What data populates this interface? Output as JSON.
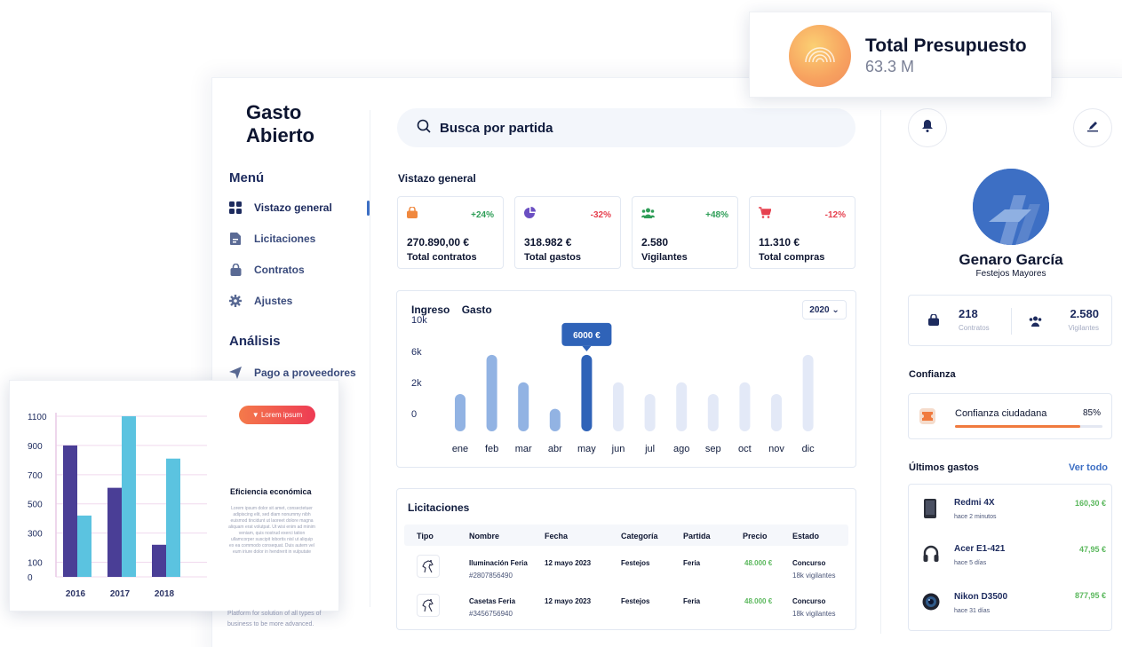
{
  "app_title_line1": "Gasto",
  "app_title_line2": "Abierto",
  "menu": {
    "title": "Menú",
    "items": [
      {
        "label": "Vistazo general",
        "icon": "grid-icon"
      },
      {
        "label": "Licitaciones",
        "icon": "document-icon"
      },
      {
        "label": "Contratos",
        "icon": "bag-icon"
      },
      {
        "label": "Ajustes",
        "icon": "gear-icon"
      }
    ]
  },
  "analysis": {
    "title": "Análisis",
    "items": [
      {
        "label": "Pago a proveedores",
        "icon": "send-icon"
      }
    ]
  },
  "search": {
    "label": "Busca por partida"
  },
  "overview": {
    "title": "Vistazo general",
    "cards": [
      {
        "pct": "+24%",
        "value": "270.890,00 €",
        "label": "Total contratos",
        "color": "#f0883e",
        "pct_color": "#2f9e58"
      },
      {
        "pct": "-32%",
        "value": "318.982 €",
        "label": "Total gastos",
        "color": "#6b4fc2",
        "pct_color": "#e6414f"
      },
      {
        "pct": "+48%",
        "value": "2.580",
        "label": "Vigilantes",
        "color": "#2f9e58",
        "pct_color": "#2f9e58"
      },
      {
        "pct": "-12%",
        "value": "11.310 €",
        "label": "Total compras",
        "color": "#e6414f",
        "pct_color": "#e6414f"
      }
    ]
  },
  "chart_panel": {
    "tab_income": "Ingreso",
    "tab_expense": "Gasto",
    "year": "2020 ⌄",
    "tooltip": "6000 €"
  },
  "chart_data": {
    "type": "bar",
    "categories": [
      "ene",
      "feb",
      "mar",
      "abr",
      "may",
      "jun",
      "jul",
      "ago",
      "sep",
      "oct",
      "nov",
      "dic"
    ],
    "values": [
      3800,
      7800,
      5000,
      2300,
      7800,
      5000,
      3800,
      5000,
      3800,
      5000,
      3800,
      7800
    ],
    "highlight_index": 4,
    "yticks": [
      "0",
      "2k",
      "6k",
      "10k"
    ],
    "ylim": [
      0,
      9600
    ],
    "colors": {
      "past": "#92b3e3",
      "highlight": "#2f63b8",
      "future": "#e3e9f7"
    }
  },
  "licitaciones": {
    "title": "Licitaciones",
    "headers": [
      "Tipo",
      "Nombre",
      "Fecha",
      "Categoría",
      "Partida",
      "Precio",
      "Estado"
    ],
    "rows": [
      {
        "name": "Iluminación Feria",
        "code": "#2807856490",
        "date": "12 mayo 2023",
        "category": "Festejos",
        "partida": "Feria",
        "price": "48.000 €",
        "status": "Concurso",
        "status_sub": "18k vigilantes"
      },
      {
        "name": "Casetas Feria",
        "code": "#3456756940",
        "date": "12 mayo 2023",
        "category": "Festejos",
        "partida": "Feria",
        "price": "48.000 €",
        "status": "Concurso",
        "status_sub": "18k vigilantes"
      }
    ]
  },
  "user": {
    "name": "Genaro García",
    "role": "Festejos Mayores",
    "contracts_value": "218",
    "contracts_label": "Contratos",
    "watchers_value": "2.580",
    "watchers_label": "Vigilantes"
  },
  "trust": {
    "title": "Confianza",
    "label": "Confianza ciudadana",
    "pct": "85%",
    "fraction": 0.85
  },
  "expenses": {
    "title": "Últimos gastos",
    "see_all": "Ver todo",
    "items": [
      {
        "name": "Redmi 4X",
        "time": "hace 2 minutos",
        "amount": "160,30 €",
        "icon": "phone-icon"
      },
      {
        "name": "Acer E1-421",
        "time": "hace 5 días",
        "amount": "47,95 €",
        "icon": "headphones-icon"
      },
      {
        "name": "Nikon D3500",
        "time": "hace 31 días",
        "amount": "877,95 €",
        "icon": "camera-lens-icon"
      }
    ]
  },
  "budget": {
    "title": "Total Presupuesto",
    "value": "63.3 M"
  },
  "eco_card": {
    "pill": "▼ Lorem ipsum",
    "title": "Eficiencia económica",
    "body": "Lorem ipsum dolor sit amet, consectetuer adipiscing elit, sed diam nonummy nibh euismod tincidunt ut laoreet dolore magna aliquam erat volutpat. Ut wisi enim ad minim veniam, quis nostrud exerci tation ullamcorper suscipit lobortis nisl ut aliquip ex ea commodo consequat. Duis autem vel eum iriure dolor in hendrerit in vulputate",
    "footer": "Platform for solution of all types of business to be more advanced."
  },
  "eco_chart_data": {
    "type": "bar",
    "categories": [
      "2016",
      "2017",
      "2018"
    ],
    "series": [
      {
        "values": [
          900,
          610,
          220
        ],
        "color": "#4a3e96"
      },
      {
        "values": [
          420,
          1100,
          810
        ],
        "color": "#5bc3e0"
      }
    ],
    "yticks": [
      "0",
      "100",
      "300",
      "500",
      "700",
      "900",
      "1100"
    ],
    "ylim": [
      0,
      1100
    ]
  }
}
